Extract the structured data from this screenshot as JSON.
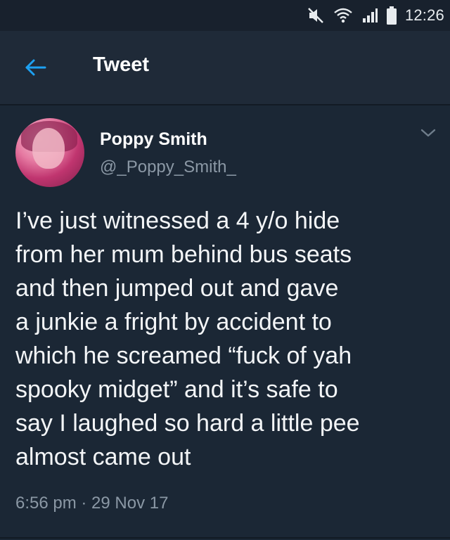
{
  "status_bar": {
    "time": "12:26",
    "icons": [
      "mute-icon",
      "wifi-icon",
      "signal-icon",
      "battery-icon"
    ]
  },
  "header": {
    "back_icon": "arrow-left-icon",
    "title": "Tweet"
  },
  "tweet": {
    "author_name": "Poppy Smith",
    "author_handle": "@_Poppy_Smith_",
    "menu_icon": "chevron-down-icon",
    "text_lines": [
      "I’ve just witnessed a 4 y/o hide",
      "from her mum behind bus seats",
      "and then jumped out and gave",
      "a junkie a fright by accident to",
      "which he screamed “fuck of yah",
      "spooky midget” and it’s safe to",
      "say I laughed so hard a little pee",
      "almost came out"
    ],
    "meta": "6:56 pm · 29 Nov 17"
  },
  "colors": {
    "background": "#1b2735",
    "header_bg": "#1f2a38",
    "accent_blue": "#1da1f2",
    "secondary_text": "#8b98a5",
    "primary_text": "#f3f5f7"
  }
}
